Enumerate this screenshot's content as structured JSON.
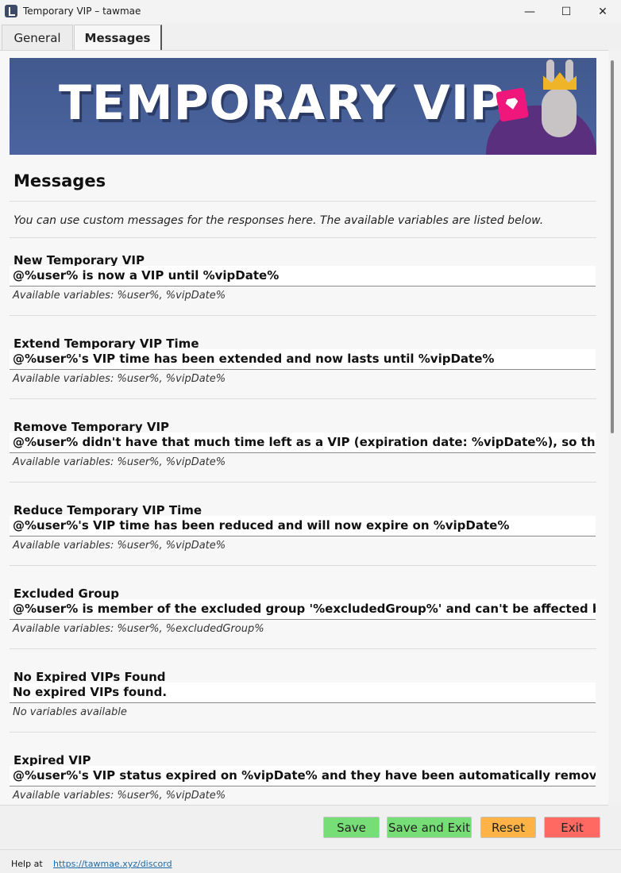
{
  "window": {
    "title": "Temporary VIP – tawmae",
    "minimize_glyph": "—",
    "maximize_glyph": "☐",
    "close_glyph": "✕"
  },
  "tabs": [
    {
      "label": "General",
      "active": false
    },
    {
      "label": "Messages",
      "active": true
    }
  ],
  "banner": {
    "text": "TEMPORARY VIP"
  },
  "page": {
    "heading": "Messages",
    "intro": "You can use custom messages for the responses here. The available variables are listed below."
  },
  "sections": [
    {
      "title": "New Temporary VIP",
      "value": "@%user% is now a VIP until %vipDate%",
      "hint": "Available variables: %user%, %vipDate%"
    },
    {
      "title": "Extend Temporary VIP Time",
      "value": "@%user%'s VIP time has been extended and now lasts until %vipDate%",
      "hint": "Available variables: %user%, %vipDate%"
    },
    {
      "title": "Remove Temporary VIP",
      "value": "@%user% didn't have that much time left as a VIP (expiration date: %vipDate%), so they have nc",
      "hint": "Available variables: %user%, %vipDate%"
    },
    {
      "title": "Reduce Temporary VIP Time",
      "value": "@%user%'s VIP time has been reduced and will now expire on %vipDate%",
      "hint": "Available variables: %user%, %vipDate%"
    },
    {
      "title": "Excluded Group",
      "value": "@%user% is member of the excluded group '%excludedGroup%' and can't be affected by Tempo",
      "hint": "Available variables: %user%, %excludedGroup%"
    },
    {
      "title": "No Expired VIPs Found",
      "value": "No expired VIPs found.",
      "hint": "No variables available"
    },
    {
      "title": "Expired VIP",
      "value": "@%user%'s VIP status expired on %vipDate% and they have been automatically removed as a VI",
      "hint": "Available variables: %user%, %vipDate%"
    }
  ],
  "buttons": {
    "save": "Save",
    "save_exit": "Save and Exit",
    "reset": "Reset",
    "exit": "Exit"
  },
  "button_colors": {
    "save": "#77dd77",
    "save_exit": "#77dd77",
    "reset": "#ffb347",
    "exit": "#ff6961"
  },
  "footer": {
    "help_label": "Help at",
    "help_link": "https://tawmae.xyz/discord"
  }
}
